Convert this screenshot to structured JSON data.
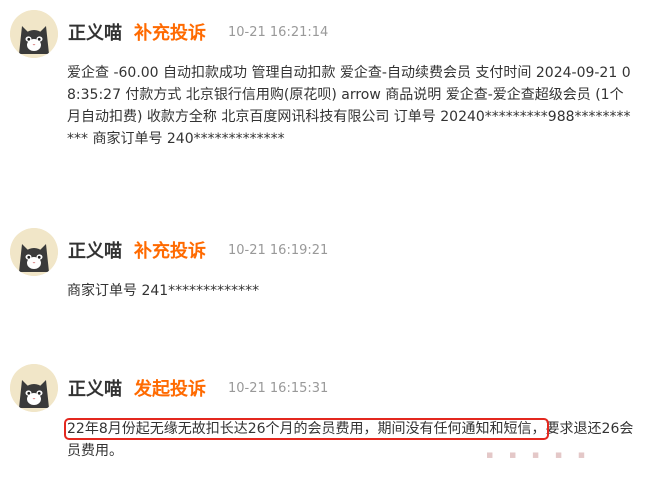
{
  "posts": [
    {
      "author": "正义喵",
      "action": "补充投诉",
      "time": "10-21 16:21:14",
      "content": "爱企查 -60.00 自动扣款成功 管理自动扣款 爱企查-自动续费会员 支付时间 2024-09-21 08:35:27 付款方式 北京银行信用购(原花呗) arrow 商品说明 爱企查-爱企查超级会员 (1个月自动扣费) 收款方全称 北京百度网讯科技有限公司 订单号 20240*********988*********** 商家订单号 240*************"
    },
    {
      "author": "正义喵",
      "action": "补充投诉",
      "time": "10-21 16:19:21",
      "content": "商家订单号 241*************"
    },
    {
      "author": "正义喵",
      "action": "发起投诉",
      "time": "10-21 16:15:31",
      "content_highlight": "22年8月份起无缘无故扣长达26个月的会员费用，期间没有任何通知和短信，",
      "content_rest": "要求退还26会员费用。"
    }
  ],
  "colors": {
    "action": "#ff6a00",
    "highlight_box": "#e3281f",
    "time": "#999999"
  }
}
